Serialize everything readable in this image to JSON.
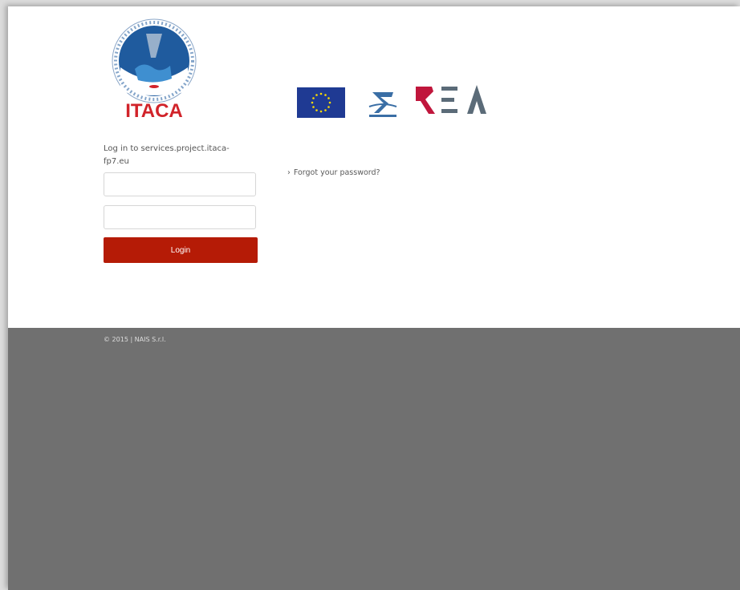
{
  "header": {
    "logo_itaca_text": "ITACA",
    "logo_itaca_ring_text": "INNOVATIVE TECHNOLOGIES AND APPLICATIONS FOR COASTAL ARCHAEOLOGICAL SITES",
    "logo_rea_text": "REA"
  },
  "login": {
    "title": "Log in to services.project.itaca-fp7.eu",
    "username_value": "",
    "password_value": "",
    "button_label": "Login",
    "forgot_chevron": "›",
    "forgot_label": "Forgot your password?"
  },
  "footer": {
    "copyright": "© 2015 | NAIS S.r.l."
  },
  "colors": {
    "login_button": "#b51b06",
    "footer_bg": "#707070",
    "rea_red": "#c0163c",
    "rea_gray": "#5b6b78",
    "eu_blue": "#1f3a93",
    "eu_star": "#ffdd00",
    "itaca_red": "#d1232a",
    "itaca_blue": "#1f5b9e"
  }
}
